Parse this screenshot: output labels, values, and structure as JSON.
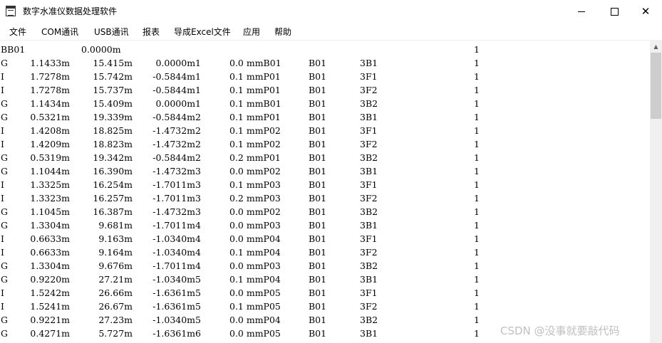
{
  "window": {
    "title": "数字水准仪数据处理软件",
    "icon": "notepad-document-icon",
    "minimize": "minimize-icon",
    "maximize": "maximize-icon",
    "close": "close-icon",
    "close_glyph": "✕"
  },
  "menu": [
    "文件",
    "COM通讯",
    "USB通讯",
    "报表",
    "导成Excel文件",
    "应用",
    "帮助"
  ],
  "header_row": {
    "id": "BB01",
    "value": "0.0000m",
    "flag": "1"
  },
  "rows": [
    [
      "G",
      "1.1433m",
      "15.415m",
      "0.0000m1",
      "0.0 mmB01",
      "B01",
      "3B1",
      "1"
    ],
    [
      "I",
      "1.7278m",
      "15.742m",
      "-0.5844m1",
      "0.1 mmP01",
      "B01",
      "3F1",
      "1"
    ],
    [
      "I",
      "1.7278m",
      "15.737m",
      "-0.5844m1",
      "0.1 mmP01",
      "B01",
      "3F2",
      "1"
    ],
    [
      "G",
      "1.1434m",
      "15.409m",
      "0.0000m1",
      "0.1 mmB01",
      "B01",
      "3B2",
      "1"
    ],
    [
      "G",
      "0.5321m",
      "19.339m",
      "-0.5844m2",
      "0.1 mmP01",
      "B01",
      "3B1",
      "1"
    ],
    [
      "I",
      "1.4208m",
      "18.825m",
      "-1.4732m2",
      "0.1 mmP02",
      "B01",
      "3F1",
      "1"
    ],
    [
      "I",
      "1.4209m",
      "18.823m",
      "-1.4732m2",
      "0.1 mmP02",
      "B01",
      "3F2",
      "1"
    ],
    [
      "G",
      "0.5319m",
      "19.342m",
      "-0.5844m2",
      "0.2 mmP01",
      "B01",
      "3B2",
      "1"
    ],
    [
      "G",
      "1.1044m",
      "16.390m",
      "-1.4732m3",
      "0.0 mmP02",
      "B01",
      "3B1",
      "1"
    ],
    [
      "I",
      "1.3325m",
      "16.254m",
      "-1.7011m3",
      "0.1 mmP03",
      "B01",
      "3F1",
      "1"
    ],
    [
      "I",
      "1.3323m",
      "16.257m",
      "-1.7011m3",
      "0.2 mmP03",
      "B01",
      "3F2",
      "1"
    ],
    [
      "G",
      "1.1045m",
      "16.387m",
      "-1.4732m3",
      "0.0 mmP02",
      "B01",
      "3B2",
      "1"
    ],
    [
      "G",
      "1.3304m",
      "9.681m",
      "-1.7011m4",
      "0.0 mmP03",
      "B01",
      "3B1",
      "1"
    ],
    [
      "I",
      "0.6633m",
      "9.163m",
      "-1.0340m4",
      "0.0 mmP04",
      "B01",
      "3F1",
      "1"
    ],
    [
      "I",
      "0.6633m",
      "9.164m",
      "-1.0340m4",
      "0.1 mmP04",
      "B01",
      "3F2",
      "1"
    ],
    [
      "G",
      "1.3304m",
      "9.676m",
      "-1.7011m4",
      "0.0 mmP03",
      "B01",
      "3B2",
      "1"
    ],
    [
      "G",
      "0.9220m",
      "27.21m",
      "-1.0340m5",
      "0.1 mmP04",
      "B01",
      "3B1",
      "1"
    ],
    [
      "I",
      "1.5242m",
      "26.66m",
      "-1.6361m5",
      "0.0 mmP05",
      "B01",
      "3F1",
      "1"
    ],
    [
      "I",
      "1.5241m",
      "26.67m",
      "-1.6361m5",
      "0.1 mmP05",
      "B01",
      "3F2",
      "1"
    ],
    [
      "G",
      "0.9221m",
      "27.23m",
      "-1.0340m5",
      "0.0 mmP04",
      "B01",
      "3B2",
      "1"
    ],
    [
      "G",
      "0.4271m",
      "5.727m",
      "-1.6361m6",
      "0.0 mmP05",
      "B01",
      "3B1",
      "1"
    ]
  ],
  "scrollbar": {
    "up_glyph": "▲"
  },
  "watermark": "CSDN @没事就要敲代码"
}
